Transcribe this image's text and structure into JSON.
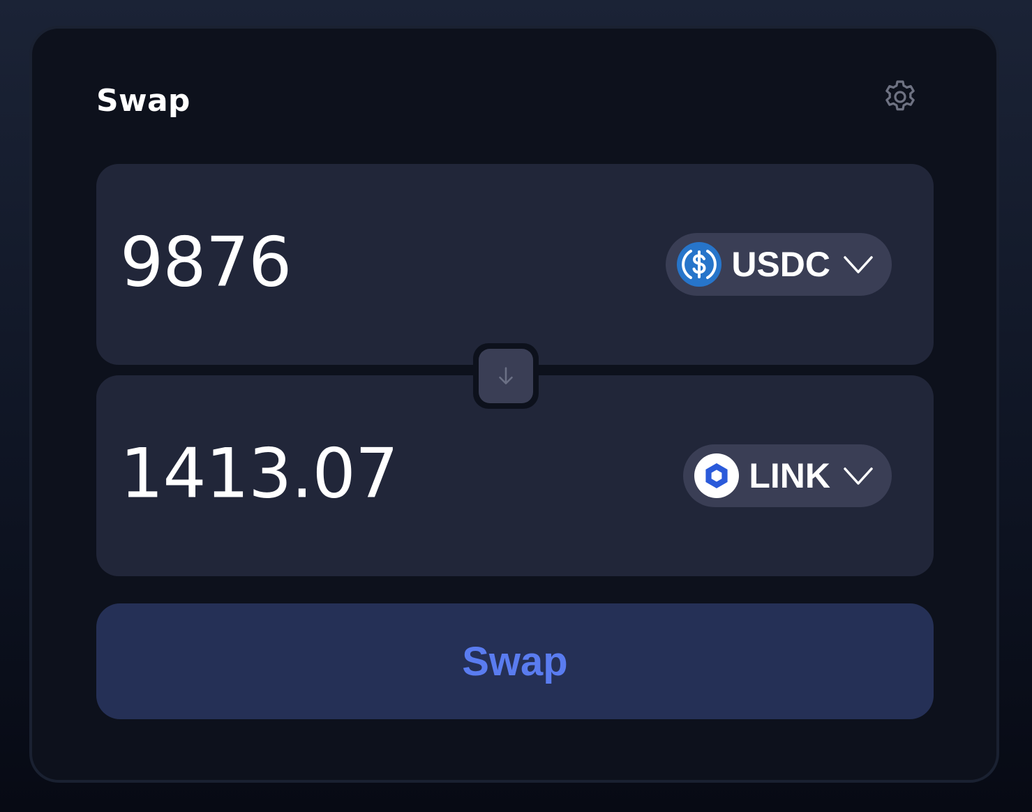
{
  "swap_card": {
    "title": "Swap",
    "settings_icon": "gear-icon"
  },
  "sell": {
    "amount": "9876",
    "token": {
      "symbol": "USDC",
      "icon": "usdc-logo-icon",
      "color": "#2775ca"
    }
  },
  "buy": {
    "amount": "1413.07",
    "token": {
      "symbol": "LINK",
      "icon": "chainlink-logo-icon",
      "color": "#2a5ada"
    }
  },
  "flip_icon": "arrow-down-icon",
  "swap_button": {
    "label": "Swap"
  },
  "colors": {
    "card_bg": "#0d111c",
    "panel_bg": "#212639",
    "pill_bg": "#3a3e55",
    "button_bg": "#253056",
    "button_text": "#5a7cf0"
  }
}
